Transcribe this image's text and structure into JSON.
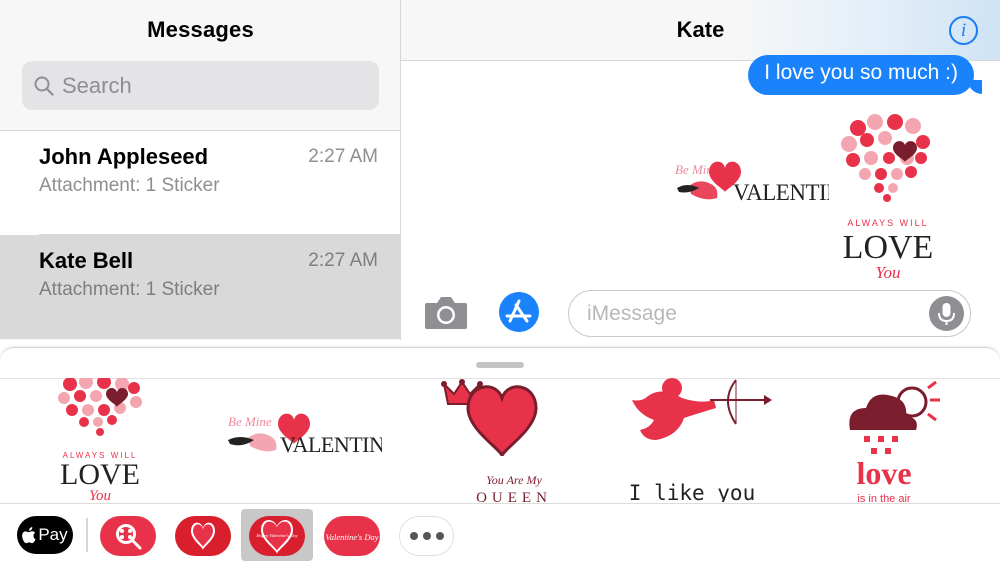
{
  "sidebar": {
    "title": "Messages",
    "search_placeholder": "Search",
    "conversations": [
      {
        "name": "John Appleseed",
        "time": "2:27 AM",
        "preview": "Attachment: 1 Sticker"
      },
      {
        "name": "Kate Bell",
        "time": "2:27 AM",
        "preview": "Attachment: 1 Sticker"
      }
    ]
  },
  "chat": {
    "title": "Kate",
    "info_icon": "info-icon",
    "message": "I love you so much :)",
    "stickers": [
      {
        "line1": "Be Mine",
        "line2": "VALENTINE"
      },
      {
        "line1": "ALWAYS WILL",
        "line2": "LOVE",
        "line3": "You"
      }
    ],
    "input_placeholder": "iMessage"
  },
  "drawer": {
    "stickers": [
      {
        "line1": "ALWAYS WILL",
        "line2": "LOVE",
        "line3": "You"
      },
      {
        "line1": "Be Mine",
        "line2": "VALENTINE"
      },
      {
        "line1": "You Are My",
        "line2": "QUEEN"
      },
      {
        "line1": "I like you"
      },
      {
        "line1": "love",
        "line2": "is in the air"
      }
    ]
  },
  "tray": {
    "pay_label": "Pay",
    "apps": [
      "search-app-icon",
      "heart-app-icon",
      "happy-valentines-day-app-icon",
      "valentines-day-app-icon",
      "more-icon"
    ],
    "selected_app_text": "Happy Valentine's Day",
    "valentines_app_text": "Valentine's Day"
  },
  "colors": {
    "accent": "#1a82fb",
    "sticker_red": "#e8324a",
    "sticker_pink": "#f4a6b0",
    "sticker_dark": "#7a1d2c"
  }
}
